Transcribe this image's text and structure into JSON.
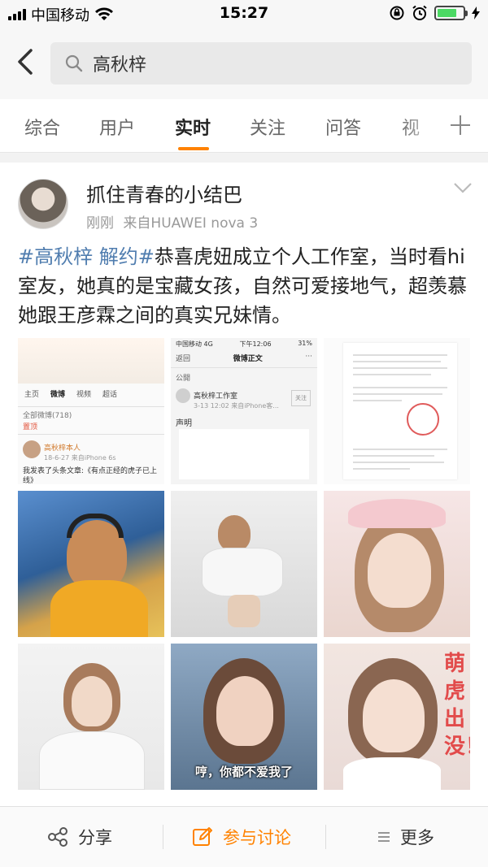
{
  "status_bar": {
    "carrier": "中国移动",
    "time": "15:27",
    "battery_level": 0.75,
    "battery_color": "#4cd964"
  },
  "search": {
    "back_icon": "chevron-left-icon",
    "query": "高秋梓"
  },
  "tabs": {
    "items": [
      "综合",
      "用户",
      "实时",
      "关注",
      "问答",
      "视"
    ],
    "active": "实时",
    "accent": "#ff8200",
    "more_icon": "plus-icon"
  },
  "post": {
    "username": "抓住青春的小结巴",
    "time": "刚刚",
    "source": "来自HUAWEI nova 3",
    "topic": "#高秋梓 解约#",
    "text": "恭喜虎妞成立个人工作室，当时看hi室友，她真的是宝藏女孩，自然可爱接地气，超羡慕她跟王彦霖之间的真实兄妹情。",
    "link_color": "#507daf",
    "images": {
      "img1": {
        "tabs": [
          "主页",
          "微博",
          "视频",
          "超话"
        ],
        "filter": "全部微博(718)",
        "hot": "置顶",
        "account": "高秋梓本人",
        "date": "18-6-27 来自iPhone 6s",
        "text": "我发表了头条文章:《有点正经的虎子已上线》"
      },
      "img2": {
        "carrier": "中国移动 4G",
        "time": "下午12:06",
        "battery": "31%",
        "back": "返回",
        "title": "微博正文",
        "visibility": "公開",
        "account": "高秋梓工作室",
        "date": "3-13 12:02 来自iPhone客...",
        "follow": "关注",
        "statement": "声明"
      },
      "img8": {
        "caption": "哼，你都不爱我了"
      },
      "img9": {
        "side_text": "萌虎出没！"
      }
    }
  },
  "actions": {
    "share": "分享",
    "discuss": "参与讨论",
    "more": "更多",
    "discuss_color": "#ff8200"
  }
}
